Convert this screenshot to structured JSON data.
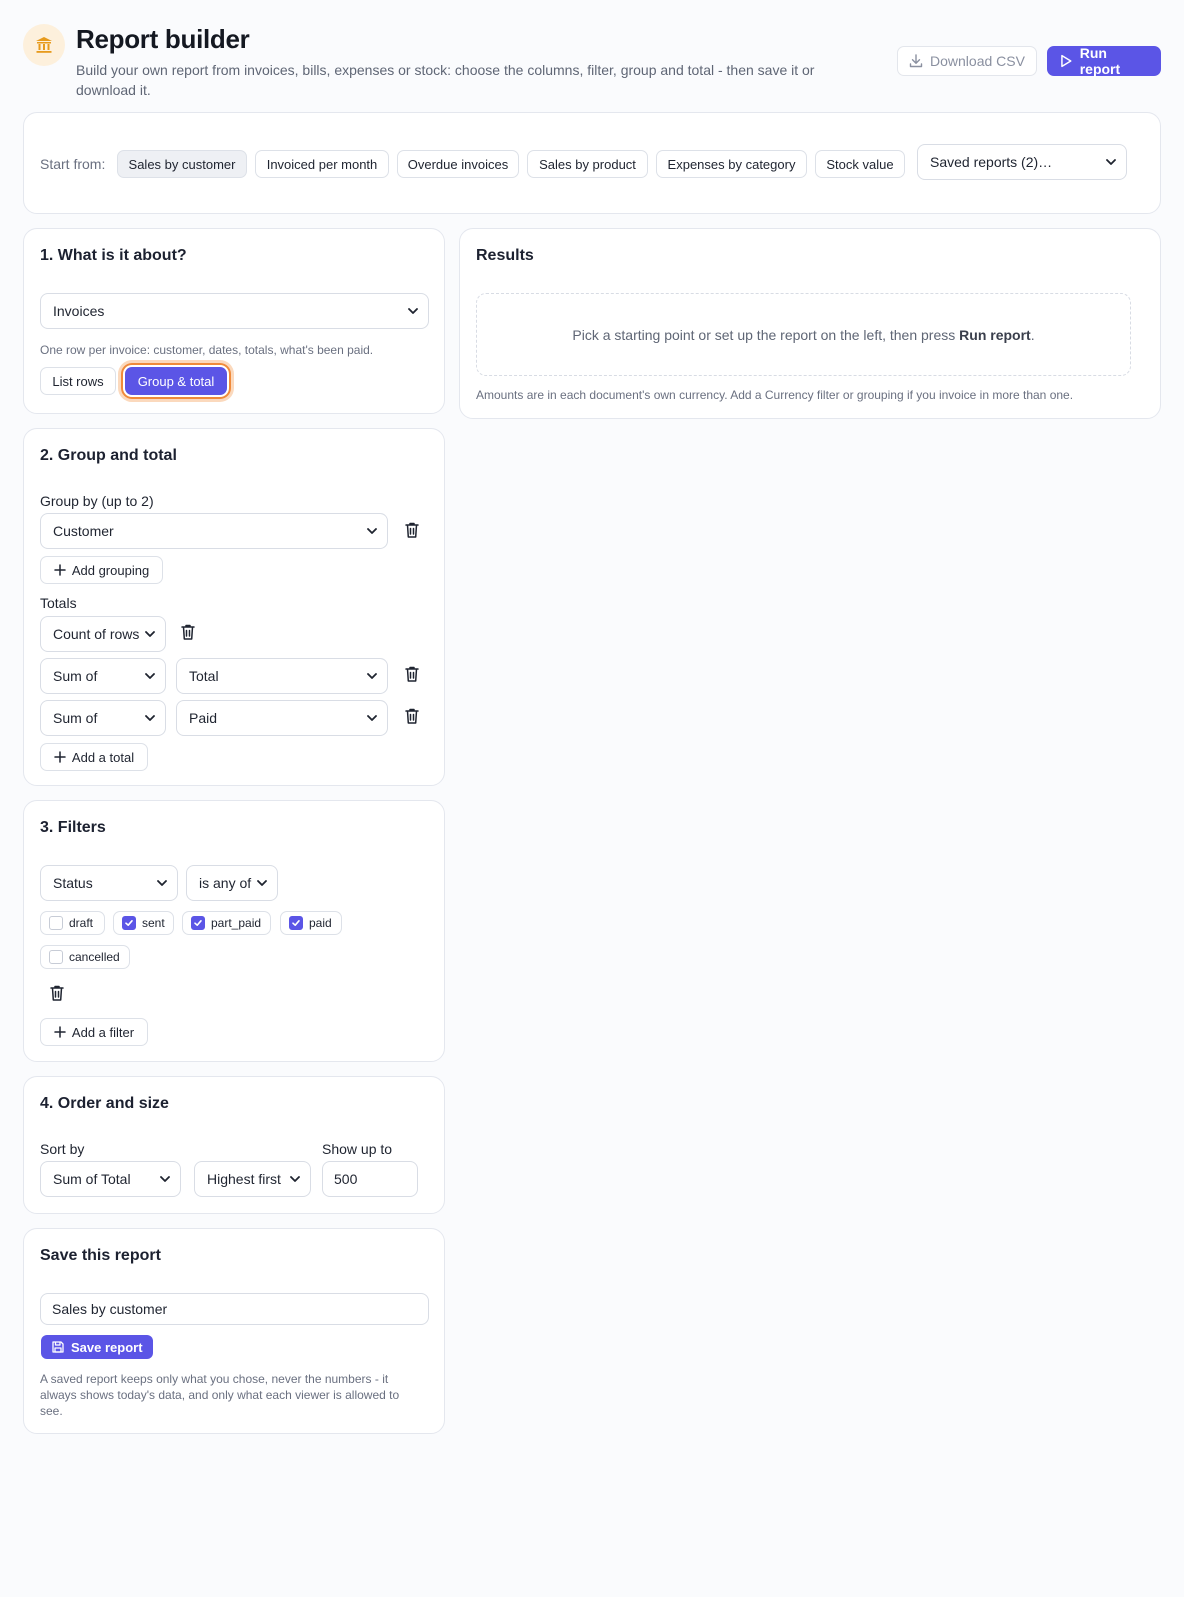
{
  "header": {
    "title": "Report builder",
    "subtitle": "Build your own report from invoices, bills, expenses or stock: choose the columns, filter, group and total - then save it or download it.",
    "download_label": "Download CSV",
    "run_label": "Run report"
  },
  "start": {
    "label": "Start from:",
    "presets": [
      "Sales by customer",
      "Invoiced per month",
      "Overdue invoices",
      "Sales by product",
      "Expenses by category",
      "Stock value"
    ],
    "active_preset": "Sales by customer",
    "saved_select": "Saved reports (2)…"
  },
  "section1": {
    "title": "1. What is it about?",
    "source": "Invoices",
    "hint": "One row per invoice: customer, dates, totals, what's been paid.",
    "mode_list": "List rows",
    "mode_group": "Group & total",
    "active_mode": "Group & total"
  },
  "section2": {
    "title": "2. Group and total",
    "group_label": "Group by (up to 2)",
    "group_value": "Customer",
    "add_grouping": "Add grouping",
    "totals_label": "Totals",
    "totals": [
      {
        "agg": "Count of rows",
        "field": ""
      },
      {
        "agg": "Sum of",
        "field": "Total"
      },
      {
        "agg": "Sum of",
        "field": "Paid"
      }
    ],
    "add_total": "Add a total"
  },
  "section3": {
    "title": "3. Filters",
    "field": "Status",
    "operator": "is any of",
    "options": [
      {
        "label": "draft",
        "checked": false
      },
      {
        "label": "sent",
        "checked": true
      },
      {
        "label": "part_paid",
        "checked": true
      },
      {
        "label": "paid",
        "checked": true
      },
      {
        "label": "cancelled",
        "checked": false
      }
    ],
    "add_filter": "Add a filter"
  },
  "section4": {
    "title": "4. Order and size",
    "sort_label": "Sort by",
    "sort_field": "Sum of Total",
    "sort_dir": "Highest first",
    "limit_label": "Show up to",
    "limit_value": "500"
  },
  "save": {
    "title": "Save this report",
    "name_value": "Sales by customer",
    "button": "Save report",
    "note": "A saved report keeps only what you chose, never the numbers - it always shows today's data, and only what each viewer is allowed to see."
  },
  "results": {
    "title": "Results",
    "empty_text_before": "Pick a starting point or set up the report on the left, then press ",
    "empty_text_bold": "Run report",
    "empty_text_after": ".",
    "note": "Amounts are in each document's own currency. Add a Currency filter or grouping if you invoice in more than one."
  },
  "colors": {
    "accent": "#5b55e6",
    "focus_ring": "#f08a3a",
    "logo_bg": "#fdf0dc",
    "logo_fg": "#e79a1c"
  },
  "icons": [
    "bank-icon",
    "download-icon",
    "play-icon",
    "chevron-down-icon",
    "trash-icon",
    "plus-icon",
    "check-icon",
    "save-icon"
  ]
}
